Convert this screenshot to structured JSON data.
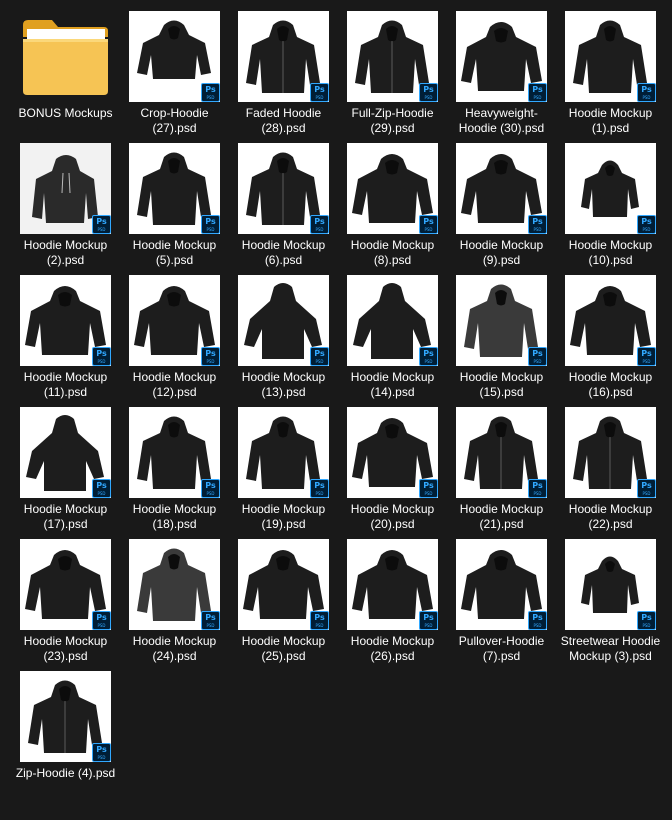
{
  "explorer": {
    "items": [
      {
        "label": "BONUS Mockups",
        "type": "folder",
        "icon": "folder-icon"
      },
      {
        "label": "Crop-Hoodie (27).psd",
        "type": "psd",
        "variant": "crop"
      },
      {
        "label": "Faded Hoodie (28).psd",
        "type": "psd",
        "variant": "zip"
      },
      {
        "label": "Full-Zip-Hoodie (29).psd",
        "type": "psd",
        "variant": "zip"
      },
      {
        "label": "Heavyweight-Hoodie (30).psd",
        "type": "psd",
        "variant": "wide"
      },
      {
        "label": "Hoodie Mockup (1).psd",
        "type": "psd",
        "variant": "pullover"
      },
      {
        "label": "Hoodie Mockup (2).psd",
        "type": "psd",
        "variant": "side",
        "bg": "light"
      },
      {
        "label": "Hoodie Mockup (5).psd",
        "type": "psd",
        "variant": "pullover"
      },
      {
        "label": "Hoodie Mockup (6).psd",
        "type": "psd",
        "variant": "zip"
      },
      {
        "label": "Hoodie Mockup (8).psd",
        "type": "psd",
        "variant": "wide"
      },
      {
        "label": "Hoodie Mockup (9).psd",
        "type": "psd",
        "variant": "wide"
      },
      {
        "label": "Hoodie Mockup (10).psd",
        "type": "psd",
        "variant": "small"
      },
      {
        "label": "Hoodie Mockup (11).psd",
        "type": "psd",
        "variant": "wide"
      },
      {
        "label": "Hoodie Mockup (12).psd",
        "type": "psd",
        "variant": "shiny"
      },
      {
        "label": "Hoodie Mockup (13).psd",
        "type": "psd",
        "variant": "flat"
      },
      {
        "label": "Hoodie Mockup (14).psd",
        "type": "psd",
        "variant": "hanging"
      },
      {
        "label": "Hoodie Mockup (15).psd",
        "type": "psd",
        "variant": "grey"
      },
      {
        "label": "Hoodie Mockup (16).psd",
        "type": "psd",
        "variant": "wide"
      },
      {
        "label": "Hoodie Mockup (17).psd",
        "type": "psd",
        "variant": "flat"
      },
      {
        "label": "Hoodie Mockup (18).psd",
        "type": "psd",
        "variant": "pullover"
      },
      {
        "label": "Hoodie Mockup (19).psd",
        "type": "psd",
        "variant": "pullover"
      },
      {
        "label": "Hoodie Mockup (20).psd",
        "type": "psd",
        "variant": "wide"
      },
      {
        "label": "Hoodie Mockup (21).psd",
        "type": "psd",
        "variant": "zip"
      },
      {
        "label": "Hoodie Mockup (22).psd",
        "type": "psd",
        "variant": "zip"
      },
      {
        "label": "Hoodie Mockup (23).psd",
        "type": "psd",
        "variant": "wide"
      },
      {
        "label": "Hoodie Mockup (24).psd",
        "type": "psd",
        "variant": "grey"
      },
      {
        "label": "Hoodie Mockup (25).psd",
        "type": "psd",
        "variant": "shiny"
      },
      {
        "label": "Hoodie Mockup (26).psd",
        "type": "psd",
        "variant": "wide"
      },
      {
        "label": "Pullover-Hoodie (7).psd",
        "type": "psd",
        "variant": "crumpled"
      },
      {
        "label": "Streetwear Hoodie Mockup (3).psd",
        "type": "psd",
        "variant": "small"
      },
      {
        "label": "Zip-Hoodie (4).psd",
        "type": "psd",
        "variant": "zip"
      }
    ],
    "badge": {
      "text": "Ps",
      "sub": "PSD",
      "icon": "photoshop-file-icon"
    },
    "colors": {
      "background": "#191919",
      "hoodie": "#1d1d1d",
      "accent": "#31a8ff"
    }
  }
}
